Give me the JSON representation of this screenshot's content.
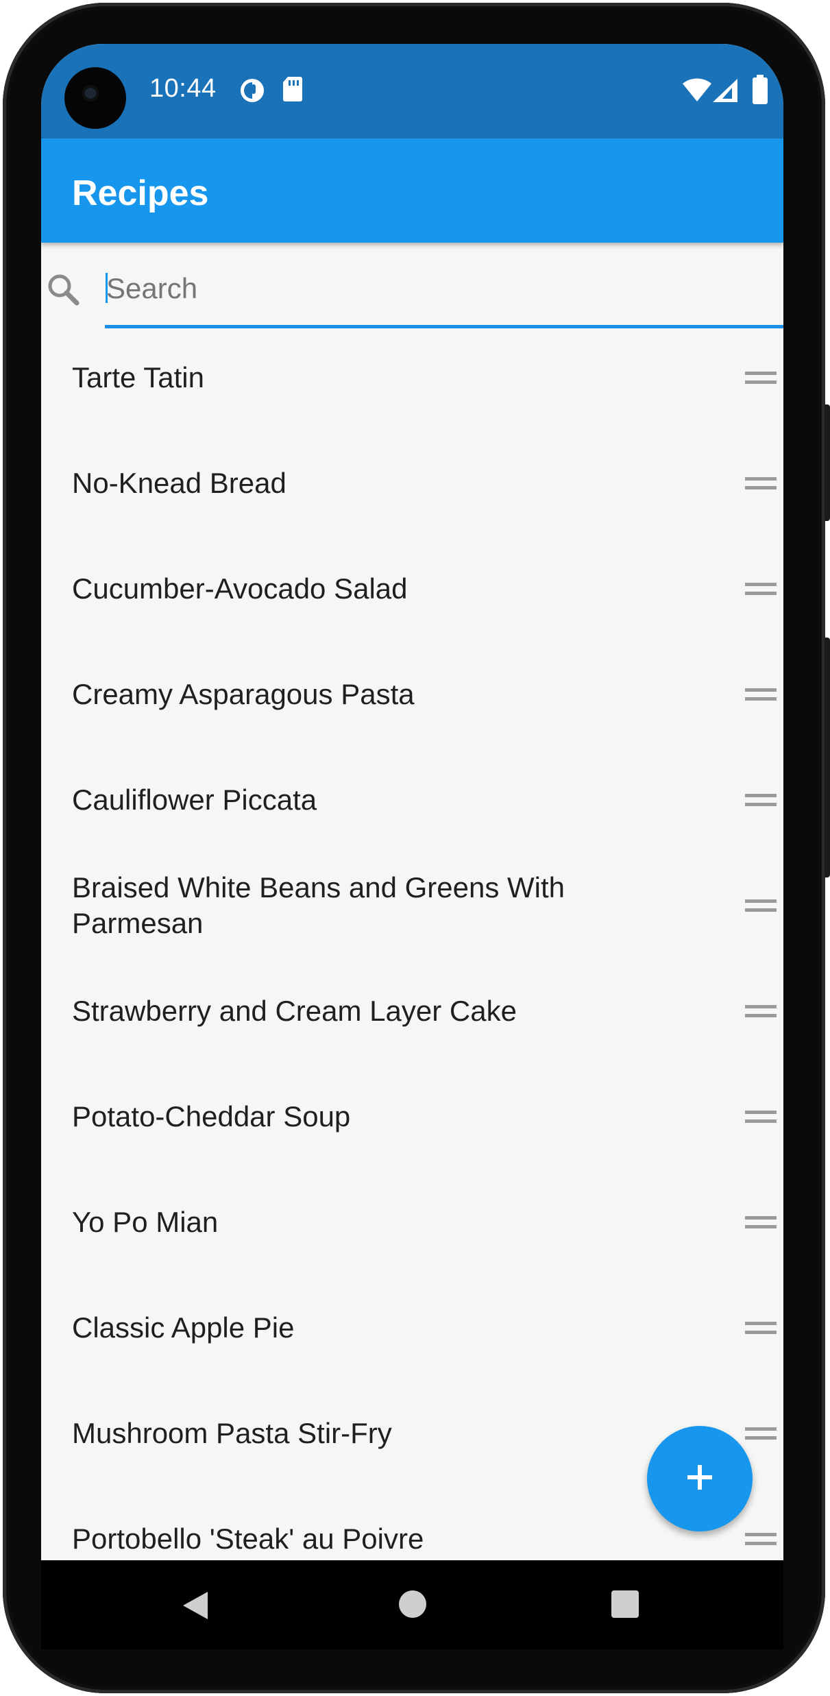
{
  "status_bar": {
    "time": "10:44",
    "icons": [
      "sync-icon",
      "sd-card-icon",
      "wifi-icon",
      "signal-icon",
      "battery-icon"
    ]
  },
  "app_bar": {
    "title": "Recipes"
  },
  "search": {
    "placeholder": "Search",
    "value": ""
  },
  "recipes": [
    "Tarte Tatin",
    "No-Knead Bread",
    "Cucumber-Avocado Salad",
    "Creamy Asparagous Pasta",
    "Cauliflower Piccata",
    "Braised White Beans and Greens With Parmesan",
    "Strawberry and Cream Layer Cake",
    "Potato-Cheddar Soup",
    "Yo Po Mian",
    "Classic Apple Pie",
    "Mushroom Pasta Stir-Fry",
    "Portobello 'Steak' au Poivre"
  ],
  "fab": {
    "icon": "plus-icon"
  },
  "nav_bar": {
    "icons": [
      "back-icon",
      "home-icon",
      "recents-icon"
    ]
  },
  "colors": {
    "status_bar": "#1a72b8",
    "app_bar": "#1696ec",
    "accent": "#1696ec",
    "background": "#f6f7f5"
  }
}
